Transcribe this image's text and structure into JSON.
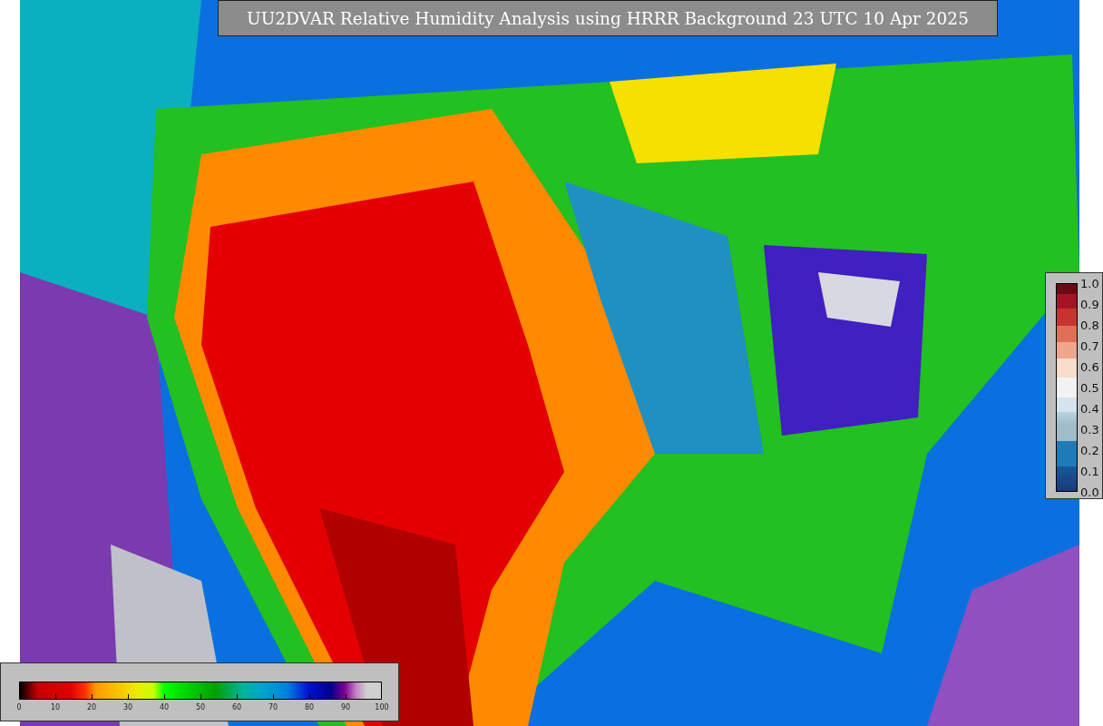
{
  "title": "UU2DVAR Relative Humidity Analysis using HRRR Background 23 UTC 10 Apr 2025",
  "humidity_colorbar": {
    "ticks": [
      "0",
      "10",
      "20",
      "30",
      "40",
      "50",
      "60",
      "70",
      "80",
      "90",
      "100"
    ]
  },
  "side_colorbar": {
    "ticks": [
      "1.0",
      "0.9",
      "0.8",
      "0.7",
      "0.6",
      "0.5",
      "0.4",
      "0.3",
      "0.2",
      "0.1",
      "0.0"
    ]
  }
}
